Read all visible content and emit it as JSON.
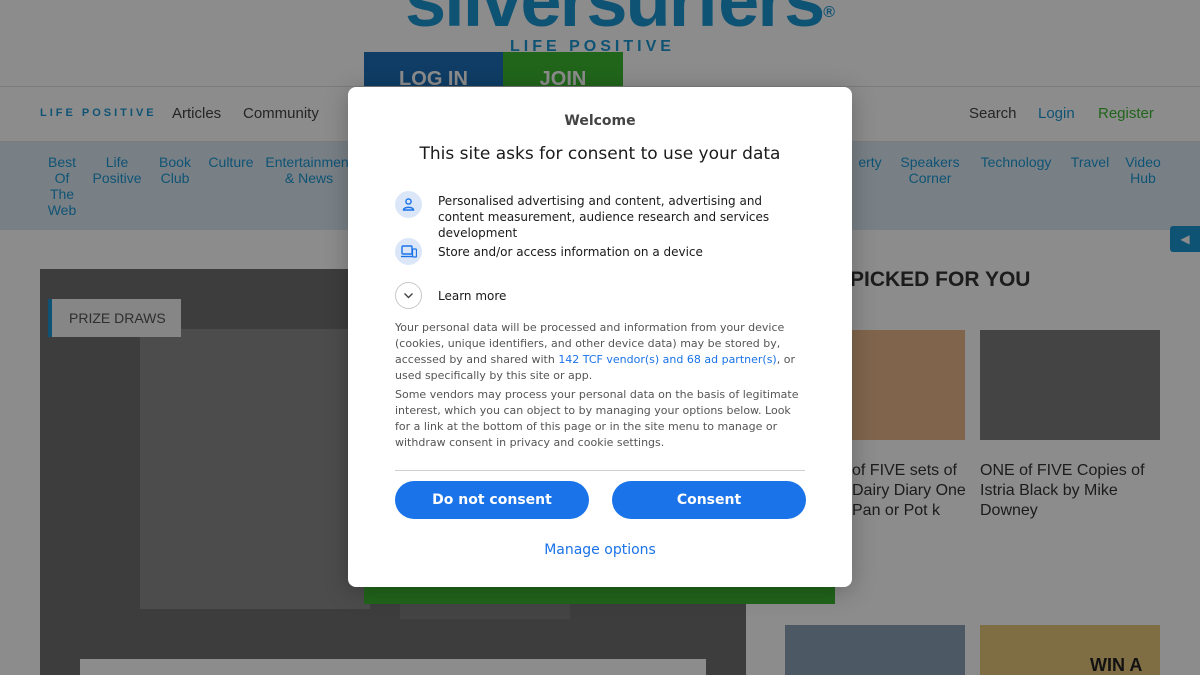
{
  "site": {
    "logo": "silversurfers",
    "logo_registered": "®",
    "tagline": "LIFE POSITIVE",
    "login_button": "LOG IN",
    "join_button": "JOIN",
    "nav": {
      "tag": "LIFE POSITIVE",
      "items": [
        "Articles",
        "Community"
      ],
      "search": "Search",
      "login": "Login",
      "register": "Register"
    },
    "categories": [
      "Best Of The Web",
      "Life Positive",
      "Book Club",
      "Culture",
      "Entertainment & News",
      "erty",
      "Speakers Corner",
      "Technology",
      "Travel",
      "Video Hub"
    ],
    "hero_badge": "PRIZE DRAWS",
    "picked_heading": "PICKED FOR YOU",
    "cards": [
      {
        "title": "of FIVE sets of Dairy Diary One Pan or Pot k"
      },
      {
        "title": "ONE of FIVE Copies of Istria Black by Mike Downey"
      }
    ],
    "side_tab": "◀",
    "bottom_card_label": "WIN A"
  },
  "dialog": {
    "welcome": "Welcome",
    "heading": "This site asks for consent to use your data",
    "purposes": [
      {
        "icon": "person-icon",
        "text": "Personalised advertising and content, advertising and content measurement, audience research and services development"
      },
      {
        "icon": "devices-icon",
        "text": "Store and/or access information on a device"
      },
      {
        "icon": "chevron-down-icon",
        "text": "Learn more"
      }
    ],
    "paragraph1_before": "Your personal data will be processed and information from your device (cookies, unique identifiers, and other device data) may be stored by, accessed by and shared with ",
    "paragraph1_link": "142 TCF vendor(s) and 68 ad partner(s)",
    "paragraph1_after": ", or used specifically by this site or app.",
    "paragraph2": "Some vendors may process your personal data on the basis of legitimate interest, which you can object to by managing your options below. Look for a link at the bottom of this page or in the site menu to manage or withdraw consent in privacy and cookie settings.",
    "do_not_consent": "Do not consent",
    "consent": "Consent",
    "manage_options": "Manage options"
  },
  "colors": {
    "primary_button": "#1a73e8",
    "brand_blue": "#1d98d3",
    "brand_green": "#3cb832"
  }
}
